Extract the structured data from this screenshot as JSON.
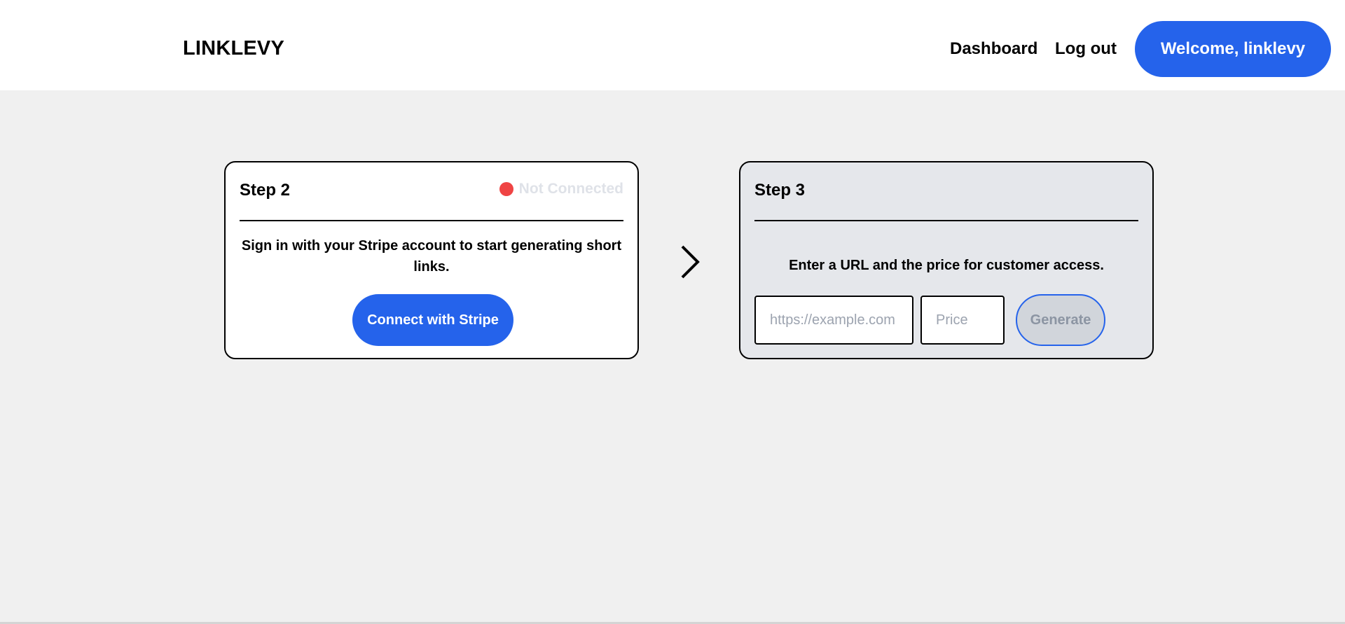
{
  "header": {
    "brand": "LINKLEVY",
    "nav": {
      "dashboard": "Dashboard",
      "logout": "Log out"
    },
    "welcome": "Welcome, linklevy"
  },
  "step2": {
    "title": "Step 2",
    "status": "Not Connected",
    "status_color": "#ef4444",
    "description": "Sign in with your Stripe account to start generating short links.",
    "button": "Connect with Stripe"
  },
  "step3": {
    "title": "Step 3",
    "description": "Enter a URL and the price for customer access.",
    "url_placeholder": "https://example.com",
    "price_placeholder": "Price",
    "button": "Generate"
  },
  "theme": {
    "accent": "#2563eb",
    "background": "#f0f0f0"
  }
}
